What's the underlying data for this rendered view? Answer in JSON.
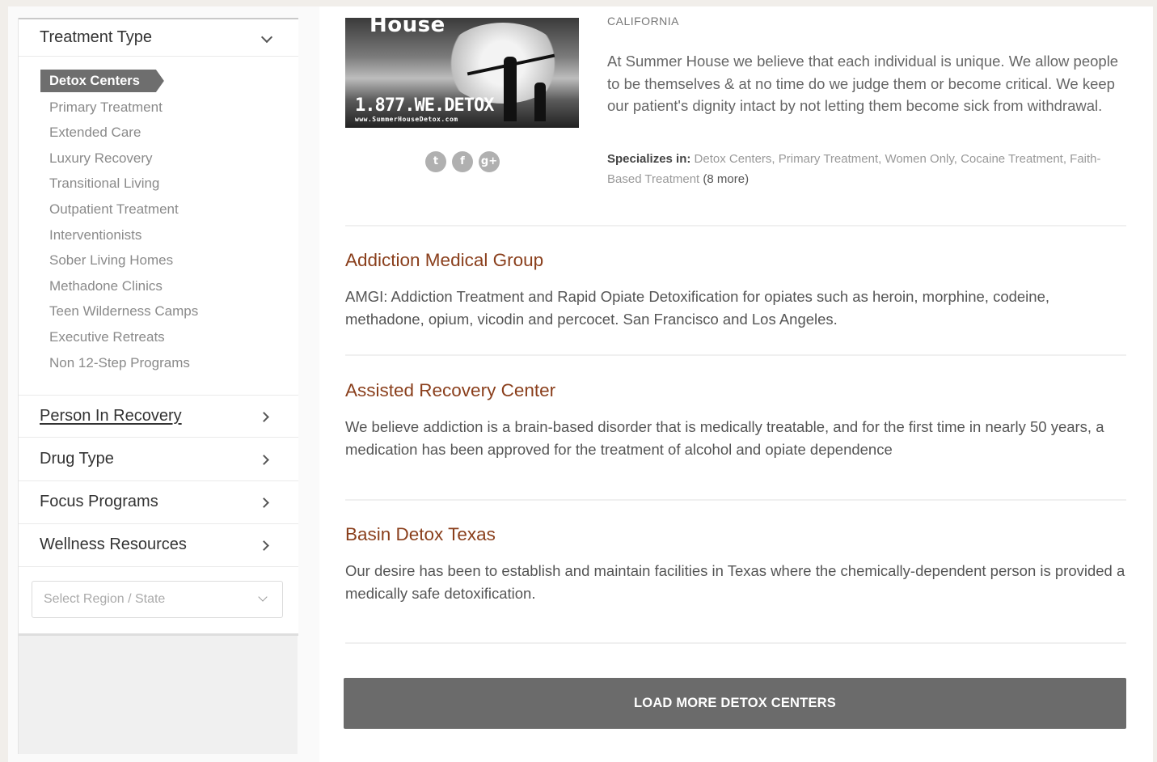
{
  "sidebar": {
    "treatment_type": {
      "label": "Treatment Type",
      "items": [
        {
          "label": "Detox Centers",
          "active": true
        },
        {
          "label": "Primary Treatment"
        },
        {
          "label": "Extended Care"
        },
        {
          "label": "Luxury Recovery"
        },
        {
          "label": "Transitional Living"
        },
        {
          "label": "Outpatient Treatment"
        },
        {
          "label": "Interventionists"
        },
        {
          "label": "Sober Living Homes"
        },
        {
          "label": "Methadone Clinics"
        },
        {
          "label": "Teen Wilderness Camps"
        },
        {
          "label": "Executive Retreats"
        },
        {
          "label": "Non 12-Step Programs"
        }
      ]
    },
    "sections": [
      {
        "label": "Person In Recovery"
      },
      {
        "label": "Drug Type"
      },
      {
        "label": "Focus Programs"
      },
      {
        "label": "Wellness Resources"
      }
    ],
    "region_select": {
      "placeholder": "Select Region / State"
    }
  },
  "featured": {
    "image": {
      "brand": "House",
      "phone": "1.877.WE.DETOX",
      "url": "www.SummerHouseDetox.com"
    },
    "social_icons": [
      "twitter-icon",
      "facebook-icon",
      "google-plus-icon"
    ],
    "state": "CALIFORNIA",
    "description": "At Summer House we believe that each individual is unique.  We allow people to be themselves & at no time do we judge them or become critical. We keep our patient's dignity intact by not letting them become sick from withdrawal.",
    "specializes_label": "Specializes in:",
    "specializes_list": "Detox Centers, Primary Treatment, Women Only, Cocaine Treatment, Faith-Based Treatment",
    "specializes_more": "(8 more)"
  },
  "listings": [
    {
      "title": "Addiction Medical Group",
      "body": "AMGI: Addiction Treatment and Rapid Opiate Detoxification for opiates such as heroin, morphine, codeine, methadone, opium, vicodin and percocet. San Francisco and Los Angeles."
    },
    {
      "title": "Assisted Recovery Center",
      "body": "We believe addiction is a brain-based disorder that is medically treatable, and for the first time in nearly 50 years, a medication has been approved for the treatment of alcohol and opiate dependence"
    },
    {
      "title": "Basin Detox Texas",
      "body": "Our desire has been to establish and maintain facilities in Texas where the chemically-dependent person is provided a medically safe detoxification."
    }
  ],
  "load_more_label": "LOAD MORE DETOX CENTERS"
}
